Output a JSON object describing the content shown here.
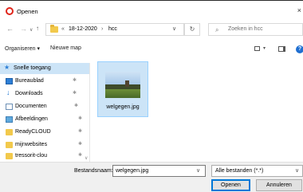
{
  "window": {
    "title": "Openen",
    "close_glyph": "×"
  },
  "nav": {
    "back_glyph": "←",
    "forward_glyph": "→",
    "recent_glyph": "∨",
    "up_glyph": "↑"
  },
  "address": {
    "overflow": "«",
    "segments": [
      "18-12-2020",
      "hcc"
    ],
    "separator": "›",
    "dropdown_glyph": "∨",
    "refresh_glyph": "↻"
  },
  "search": {
    "placeholder": "Zoeken in hcc",
    "icon": "search-icon",
    "glyph": "⌕"
  },
  "toolbar": {
    "organize_label": "Organiseren ▾",
    "new_folder_label": "Nieuwe map",
    "view_dd_glyph": "▾",
    "help_glyph": "?"
  },
  "sidebar": {
    "items": [
      {
        "label": "Snelle toegang",
        "icon": "star-icon",
        "selected": true
      },
      {
        "label": "Bureaublad",
        "icon": "desktop-icon",
        "pinned": true
      },
      {
        "label": "Downloads",
        "icon": "download-icon",
        "pinned": true
      },
      {
        "label": "Documenten",
        "icon": "document-icon",
        "pinned": true
      },
      {
        "label": "Afbeeldingen",
        "icon": "pictures-icon",
        "pinned": true
      },
      {
        "label": "ReadyCLOUD",
        "icon": "folder-icon",
        "pinned": true
      },
      {
        "label": "mijnwebsites",
        "icon": "folder-icon",
        "pinned": true
      },
      {
        "label": "tressorit-clou",
        "icon": "folder-icon",
        "pinned": true
      }
    ],
    "pin_glyph": "✱",
    "star_glyph": "★",
    "download_glyph": "↓",
    "scroll_glyph": "∨"
  },
  "files": [
    {
      "name": "welgegen.jpg",
      "selected": true
    }
  ],
  "footer": {
    "filename_label": "Bestandsnaam:",
    "filename_value": "welgegen.jpg",
    "filetype_value": "Alle bestanden (*.*)",
    "dd_glyph": "∨",
    "open_label": "Openen",
    "cancel_label": "Annuleren"
  },
  "colors": {
    "selection": "#cce4f7",
    "accent": "#0078d7",
    "app_icon": "#e0251b",
    "folder": "#f2c94c"
  }
}
